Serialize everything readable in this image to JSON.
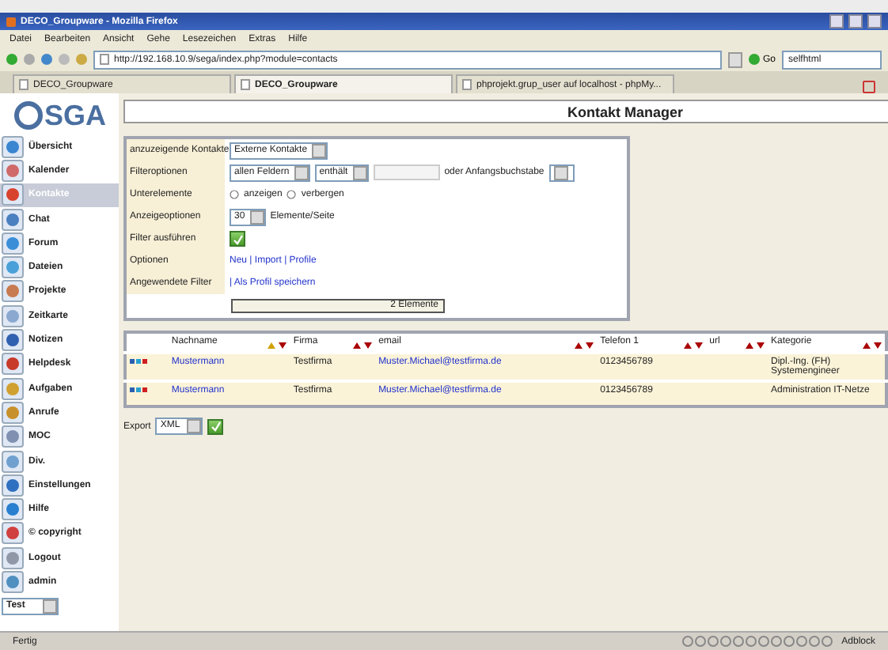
{
  "window": {
    "title": "DECO_Groupware - Mozilla Firefox"
  },
  "menu": [
    "Datei",
    "Bearbeiten",
    "Ansicht",
    "Gehe",
    "Lesezeichen",
    "Extras",
    "Hilfe"
  ],
  "address": {
    "value": "http://192.168.10.9/sega/index.php?module=contacts"
  },
  "go_button": "Go",
  "search": {
    "value": "selfhtml"
  },
  "tabs": [
    {
      "label": "DECO_Groupware",
      "selected": false
    },
    {
      "label": "DECO_Groupware",
      "selected": true
    },
    {
      "label": "phprojekt.grup_user auf localhost - phpMy...",
      "selected": false
    }
  ],
  "sidebar": {
    "logo": "SGA",
    "items": [
      {
        "label": "Übersicht",
        "selected": false,
        "color": "#3a86d0"
      },
      {
        "label": "Kalender",
        "selected": false,
        "color": "#d06a6a"
      },
      {
        "label": "Kontakte",
        "selected": true,
        "color": "#d8432e"
      },
      {
        "label": "Chat",
        "selected": false,
        "color": "#4a7fc0"
      },
      {
        "label": "Forum",
        "selected": false,
        "color": "#3a8ed8"
      },
      {
        "label": "Dateien",
        "selected": false,
        "color": "#4aa0d8"
      },
      {
        "label": "Projekte",
        "selected": false,
        "color": "#c87a50"
      },
      {
        "label": "Zeitkarte",
        "selected": false,
        "color": "#8aa8d0"
      },
      {
        "label": "Notizen",
        "selected": false,
        "color": "#3060b0"
      },
      {
        "label": "Helpdesk",
        "selected": false,
        "color": "#c83a2a"
      },
      {
        "label": "Aufgaben",
        "selected": false,
        "color": "#d0a030"
      },
      {
        "label": "Anrufe",
        "selected": false,
        "color": "#c8902a"
      },
      {
        "label": "MOC",
        "selected": false,
        "color": "#8090b0"
      },
      {
        "label": "Div.",
        "selected": false,
        "color": "#70a0d0"
      },
      {
        "label": "Einstellungen",
        "selected": false,
        "color": "#3070c0"
      },
      {
        "label": "Hilfe",
        "selected": false,
        "color": "#2a80d0"
      },
      {
        "label": "© copyright",
        "selected": false,
        "color": "#d04040"
      },
      {
        "label": "Logout",
        "selected": false,
        "color": "#9098a8"
      },
      {
        "label": "admin",
        "selected": false,
        "color": "#5090c0"
      }
    ],
    "profile_select": "Test"
  },
  "page_title": "Kontakt Manager",
  "filter": {
    "rows": [
      {
        "label": "anzuzeigende Kontakte",
        "kind": "select",
        "select": "Externe Kontakte"
      },
      {
        "label": "Filteroptionen",
        "kind": "filter",
        "field": "allen Feldern",
        "operator": "enthält",
        "or_label": "oder Anfangsbuchstabe"
      },
      {
        "label": "Unterelemente",
        "kind": "radio",
        "options": [
          {
            "label": "anzeigen",
            "selected": false
          },
          {
            "label": "verbergen",
            "selected": false
          }
        ]
      },
      {
        "label": "Anzeigeoptionen",
        "kind": "perpage",
        "select": "30",
        "suffix": "Elemente/Seite"
      },
      {
        "label": "Filter ausführen",
        "kind": "apply"
      },
      {
        "label": "Optionen",
        "kind": "links",
        "text": "Neu | Import | Profile"
      },
      {
        "label": "Angewendete Filter",
        "kind": "links",
        "text": "| Als Profil speichern"
      }
    ],
    "count": "2 Elemente"
  },
  "table": {
    "columns": [
      {
        "label": "Nachname",
        "sorted": true
      },
      {
        "label": "Firma",
        "sorted": false
      },
      {
        "label": "email",
        "sorted": false
      },
      {
        "label": "Telefon 1",
        "sorted": false
      },
      {
        "label": "url",
        "sorted": false
      },
      {
        "label": "Kategorie",
        "sorted": false
      }
    ],
    "rows": [
      {
        "marks": [
          {
            "color": "#2a5fb0"
          },
          {
            "color": "#2aa0d0"
          },
          {
            "color": "#d02020"
          }
        ],
        "cells": [
          "Mustermann",
          "Testfirma",
          "Muster.Michael@testfirma.de",
          "0123456789",
          "",
          "Dipl.-Ing. (FH) Systemengineer"
        ]
      },
      {
        "marks": [
          {
            "color": "#2a5fb0"
          },
          {
            "color": "#2aa0d0"
          },
          {
            "color": "#d02020"
          }
        ],
        "cells": [
          "Mustermann",
          "Testfirma",
          "Muster.Michael@testfirma.de",
          "0123456789",
          "",
          "Administration IT-Netze"
        ]
      }
    ]
  },
  "export": {
    "label": "Export",
    "select": "XML"
  },
  "status_bar": {
    "text": "Fertig",
    "addon": "Adblock"
  }
}
